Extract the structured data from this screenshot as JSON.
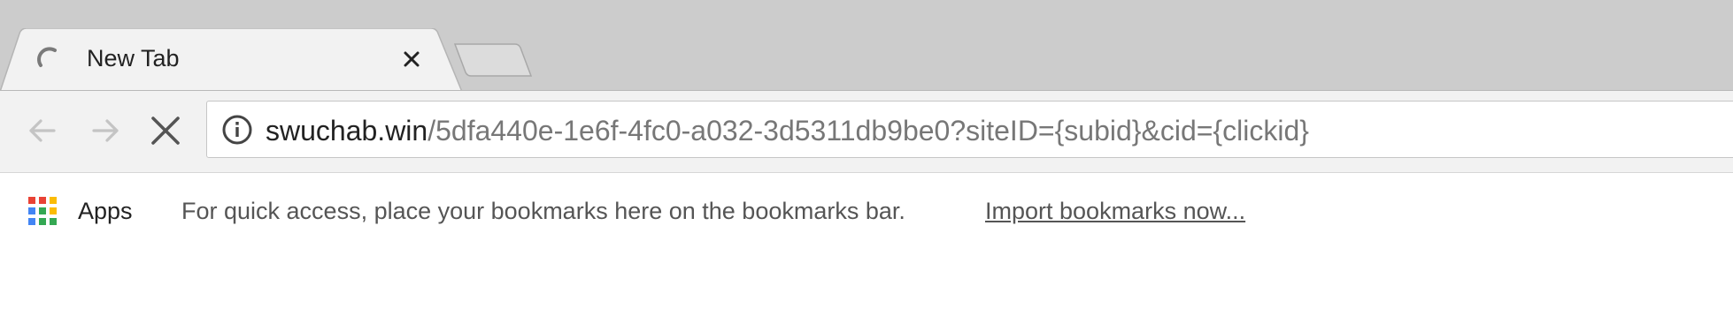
{
  "tab": {
    "title": "New Tab",
    "loading_icon": "loading-spinner-icon",
    "close_icon": "close-icon"
  },
  "toolbar": {
    "back_icon": "arrow-left-icon",
    "forward_icon": "arrow-right-icon",
    "stop_icon": "stop-x-icon"
  },
  "omnibox": {
    "security_icon": "info-icon",
    "url_host": "swuchab.win",
    "url_path": "/5dfa440e-1e6f-4fc0-a032-3d5311db9be0?siteID={subid}&cid={clickid}"
  },
  "bookmarks_bar": {
    "apps_label": "Apps",
    "hint_text": "For quick access, place your bookmarks here on the bookmarks bar.",
    "import_link": "Import bookmarks now..."
  },
  "colors": {
    "tabstrip": "#cccccc",
    "active_tab": "#f2f2f2",
    "toolbar": "#f2f2f2",
    "url_host": "#222222",
    "url_path": "#777777",
    "apps_grid": [
      "#e94235",
      "#fbbc04",
      "#34a853",
      "#4285f4"
    ]
  }
}
